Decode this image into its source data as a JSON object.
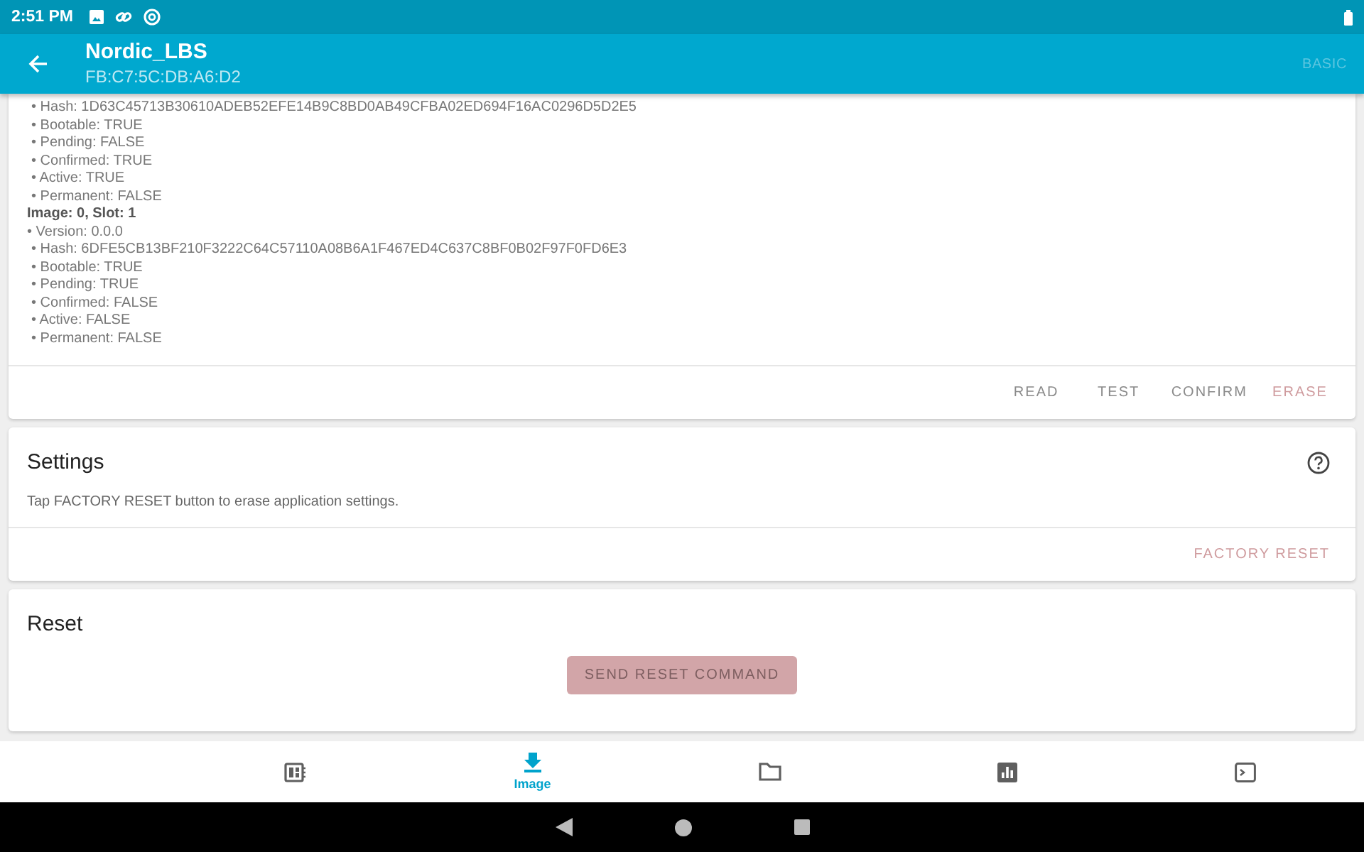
{
  "status_bar": {
    "time": "2:51 PM"
  },
  "app_bar": {
    "title": "Nordic_LBS",
    "subtitle": "FB:C7:5C:DB:A6:D2",
    "mode_button": "BASIC"
  },
  "images_card": {
    "lines": [
      {
        "kind": "bullet",
        "text": "• Hash: 1D63C45713B30610ADEB52EFE14B9C8BD0AB49CFBA02ED694F16AC0296D5D2E5"
      },
      {
        "kind": "bullet",
        "text": "• Bootable: TRUE"
      },
      {
        "kind": "bullet",
        "text": "• Pending: FALSE"
      },
      {
        "kind": "bullet",
        "text": "• Confirmed: TRUE"
      },
      {
        "kind": "bullet",
        "text": "• Active: TRUE"
      },
      {
        "kind": "bullet",
        "text": "• Permanent: FALSE"
      },
      {
        "kind": "heading",
        "text": "Image: 0, Slot: 1"
      },
      {
        "kind": "top",
        "text": "• Version: 0.0.0"
      },
      {
        "kind": "bullet",
        "text": "• Hash: 6DFE5CB13BF210F3222C64C57110A08B6A1F467ED4C637C8BF0B02F97F0FD6E3"
      },
      {
        "kind": "bullet",
        "text": "• Bootable: TRUE"
      },
      {
        "kind": "bullet",
        "text": "• Pending: TRUE"
      },
      {
        "kind": "bullet",
        "text": "• Confirmed: FALSE"
      },
      {
        "kind": "bullet",
        "text": "• Active: FALSE"
      },
      {
        "kind": "bullet",
        "text": "• Permanent: FALSE"
      }
    ],
    "actions": [
      {
        "label": "READ",
        "kind": "plain"
      },
      {
        "label": "TEST",
        "kind": "plain"
      },
      {
        "label": "CONFIRM",
        "kind": "plain"
      },
      {
        "label": "ERASE",
        "kind": "accent"
      }
    ]
  },
  "settings_card": {
    "title": "Settings",
    "description": "Tap FACTORY RESET button to erase application settings.",
    "action": "FACTORY RESET"
  },
  "reset_card": {
    "title": "Reset",
    "action": "SEND RESET COMMAND"
  },
  "bottom_nav": [
    {
      "kind": "dashboard",
      "selected": false
    },
    {
      "kind": "download",
      "label": "Image",
      "selected": true
    },
    {
      "kind": "folder",
      "selected": false
    },
    {
      "kind": "chart",
      "selected": false
    },
    {
      "kind": "terminal",
      "selected": false
    }
  ]
}
